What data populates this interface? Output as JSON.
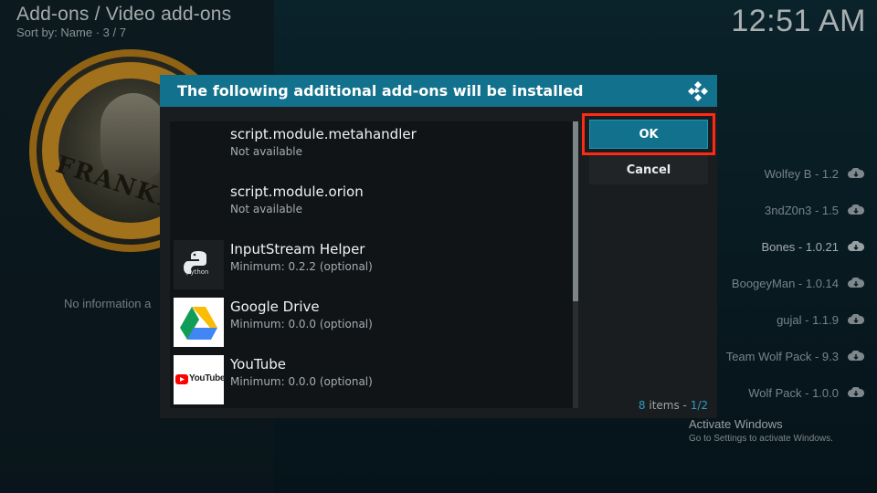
{
  "header": {
    "path": "Add-ons / Video add-ons",
    "sort": "Sort by: Name  ·  3 / 7",
    "clock": "12:51 AM"
  },
  "poster": {
    "text": "FRANKEN"
  },
  "left_panel": {
    "no_info": "No information a"
  },
  "background_list": [
    {
      "label": "Wolfey B - 1.2",
      "icon": "cloud-download-icon"
    },
    {
      "label": "3ndZ0n3 - 1.5",
      "icon": "cloud-download-icon"
    },
    {
      "label": "Bones - 1.0.21",
      "icon": "cloud-download-icon"
    },
    {
      "label": "BoogeyMan - 1.0.14",
      "icon": "cloud-download-icon"
    },
    {
      "label": "gujal - 1.1.9",
      "icon": "cloud-download-icon"
    },
    {
      "label": "Team Wolf Pack - 9.3",
      "icon": "cloud-download-icon"
    },
    {
      "label": "Wolf Pack - 1.0.0",
      "icon": "cloud-download-icon"
    }
  ],
  "watermark": {
    "title": "Activate Windows",
    "subtitle": "Go to Settings to activate Windows."
  },
  "dialog": {
    "title": "The following additional add-ons will be installed",
    "items": [
      {
        "title": "script.module.metahandler",
        "subtitle": "Not available",
        "icon": "none"
      },
      {
        "title": "script.module.orion",
        "subtitle": "Not available",
        "icon": "none"
      },
      {
        "title": "InputStream Helper",
        "subtitle": "Minimum: 0.2.2 (optional)",
        "icon": "python-icon",
        "icon_text": "python"
      },
      {
        "title": "Google Drive",
        "subtitle": "Minimum: 0.0.0 (optional)",
        "icon": "google-drive-icon"
      },
      {
        "title": "YouTube",
        "subtitle": "Minimum: 0.0.0 (optional)",
        "icon": "youtube-icon",
        "icon_text": "YouTube"
      }
    ],
    "ok_label": "OK",
    "cancel_label": "Cancel",
    "count_items": "8",
    "count_items_label": "items - ",
    "count_page": "1/2"
  },
  "colors": {
    "accent": "#12718d",
    "highlight": "#ff2a13",
    "page_count": "#2b9bc2"
  }
}
